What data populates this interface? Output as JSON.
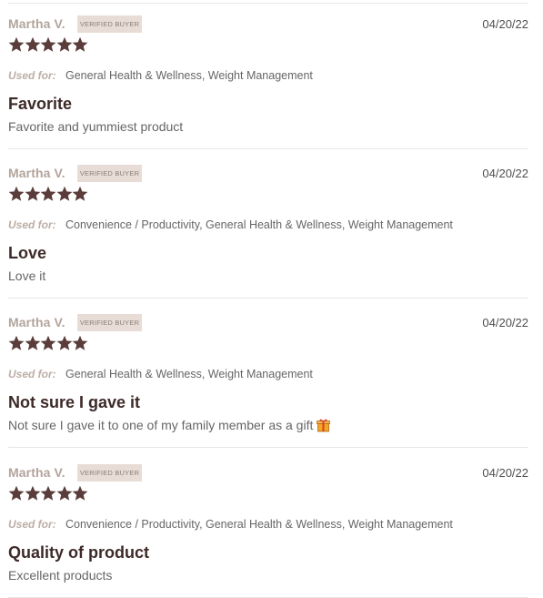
{
  "colors": {
    "star": "#5a3d3b",
    "title": "#3d2a29",
    "reviewer": "#b3a49c",
    "badge_bg": "#e8ddd6"
  },
  "reviews": [
    {
      "reviewer": "Martha V.",
      "badge": "VERIFIED BUYER",
      "date": "04/20/22",
      "rating": 5,
      "used_for_label": "Used for:",
      "used_for": "General Health & Wellness, Weight Management",
      "title": "Favorite",
      "body": "Favorite and yummiest product",
      "body_icon": null
    },
    {
      "reviewer": "Martha V.",
      "badge": "VERIFIED BUYER",
      "date": "04/20/22",
      "rating": 5,
      "used_for_label": "Used for:",
      "used_for": "Convenience / Productivity, General Health & Wellness, Weight Management",
      "title": "Love",
      "body": "Love it",
      "body_icon": null
    },
    {
      "reviewer": "Martha V.",
      "badge": "VERIFIED BUYER",
      "date": "04/20/22",
      "rating": 5,
      "used_for_label": "Used for:",
      "used_for": "General Health & Wellness, Weight Management",
      "title": "Not sure I gave it",
      "body": "Not sure I gave it to one of my family member as a gift",
      "body_icon": "gift-icon"
    },
    {
      "reviewer": "Martha V.",
      "badge": "VERIFIED BUYER",
      "date": "04/20/22",
      "rating": 5,
      "used_for_label": "Used for:",
      "used_for": "Convenience / Productivity, General Health & Wellness, Weight Management",
      "title": "Quality of product",
      "body": "Excellent products",
      "body_icon": null
    }
  ]
}
